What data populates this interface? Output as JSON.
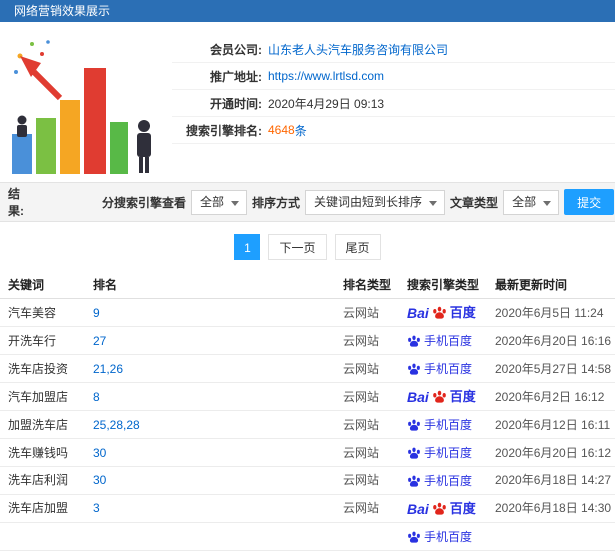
{
  "header": {
    "title": "网络营销效果展示"
  },
  "info": {
    "rows": [
      {
        "label": "会员公司:",
        "value": "山东老人头汽车服务咨询有限公司"
      },
      {
        "label": "推广地址:",
        "value": "https://www.lrtlsd.com"
      },
      {
        "label": "开通时间:",
        "value": "2020年4月29日 09:13"
      },
      {
        "label": "搜索引擎排名:",
        "value": "4648",
        "suffix": "条"
      }
    ]
  },
  "filters": {
    "section_label": "结果:",
    "engine_label": "分搜索引擎查看",
    "engine_value": "全部",
    "sort_label": "排序方式",
    "sort_value": "关键词由短到长排序",
    "article_label": "文章类型",
    "article_value": "全部",
    "submit_label": "提交"
  },
  "pagination": {
    "current": "1",
    "next": "下一页",
    "last": "尾页"
  },
  "table": {
    "headers": [
      "关键词",
      "排名",
      "排名类型",
      "搜索引擎类型",
      "最新更新时间"
    ],
    "rows": [
      {
        "keyword": "汽车美容",
        "rank": "9",
        "rank_type": "云网站",
        "engine": "baidu",
        "time": "2020年6月5日 11:24"
      },
      {
        "keyword": "开洗车行",
        "rank": "27",
        "rank_type": "云网站",
        "engine": "mobile",
        "time": "2020年6月20日 16:16"
      },
      {
        "keyword": "洗车店投资",
        "rank": "21,26",
        "rank_type": "云网站",
        "engine": "mobile",
        "time": "2020年5月27日 14:58"
      },
      {
        "keyword": "汽车加盟店",
        "rank": "8",
        "rank_type": "云网站",
        "engine": "baidu",
        "time": "2020年6月2日 16:12"
      },
      {
        "keyword": "加盟洗车店",
        "rank": "25,28,28",
        "rank_type": "云网站",
        "engine": "mobile",
        "time": "2020年6月12日 16:11"
      },
      {
        "keyword": "洗车赚钱吗",
        "rank": "30",
        "rank_type": "云网站",
        "engine": "mobile",
        "time": "2020年6月20日 16:12"
      },
      {
        "keyword": "洗车店利润",
        "rank": "30",
        "rank_type": "云网站",
        "engine": "mobile",
        "time": "2020年6月18日 14:27"
      },
      {
        "keyword": "洗车店加盟",
        "rank": "3",
        "rank_type": "云网站",
        "engine": "baidu",
        "time": "2020年6月18日 14:30"
      },
      {
        "keyword": "",
        "rank": "",
        "rank_type": "",
        "engine": "mobile",
        "time": ""
      }
    ]
  },
  "engine_labels": {
    "baidu_bai": "Bai",
    "baidu_du": "百度",
    "mobile": "手机百度"
  },
  "colors": {
    "header_bg": "#2b6fb5",
    "link": "#0066cc",
    "highlight": "#ff6600",
    "button": "#1e9fff",
    "baidu_blue": "#2932e1",
    "baidu_red": "#e1251b"
  }
}
